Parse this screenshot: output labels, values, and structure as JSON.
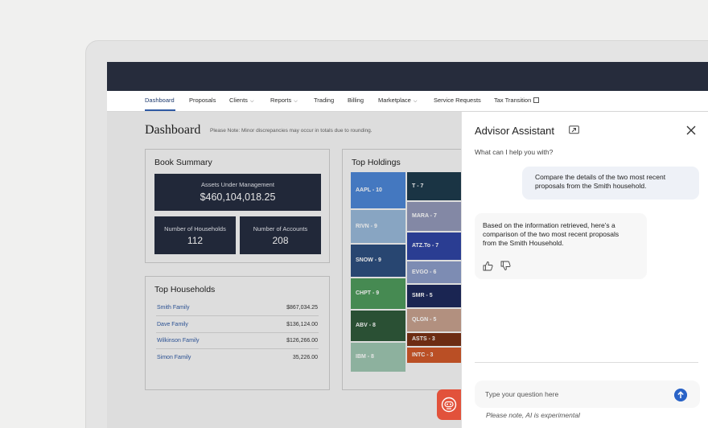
{
  "nav": {
    "items": [
      {
        "label": "Dashboard",
        "active": true
      },
      {
        "label": "Proposals"
      },
      {
        "label": "Clients",
        "dropdown": true
      },
      {
        "label": "Reports",
        "dropdown": true
      },
      {
        "label": "Trading"
      },
      {
        "label": "Billing"
      },
      {
        "label": "Marketplace",
        "dropdown": true
      },
      {
        "label": "Service Requests"
      },
      {
        "label": "Tax Transition",
        "external": true
      }
    ]
  },
  "dashboard": {
    "title": "Dashboard",
    "note": "Please Note: Minor discrepancies may occur in totals due to rounding."
  },
  "book_summary": {
    "title": "Book Summary",
    "aum_label": "Assets Under Management",
    "aum_value": "$460,104,018.25",
    "households_label": "Number of Households",
    "households_value": "112",
    "accounts_label": "Number of Accounts",
    "accounts_value": "208"
  },
  "top_households": {
    "title": "Top Households",
    "rows": [
      {
        "name": "Smith Family",
        "value": "$867,034.25"
      },
      {
        "name": "Dave Family",
        "value": "$136,124.00"
      },
      {
        "name": "Wilkinson Family",
        "value": "$126,266.00"
      },
      {
        "name": "Simon Family",
        "value": "35,226.00"
      }
    ]
  },
  "top_holdings": {
    "title": "Top Holdings",
    "tiles": [
      {
        "label": "AAPL - 10",
        "color": "#4c86d6"
      },
      {
        "label": "RIVN - 9",
        "color": "#98b8d8"
      },
      {
        "label": "SNOW - 9",
        "color": "#2d4e7e"
      },
      {
        "label": "CHPT - 9",
        "color": "#4f9a5c"
      },
      {
        "label": "ABV - 8",
        "color": "#2f5a3a"
      },
      {
        "label": "IBM - 8",
        "color": "#9ec6b0"
      },
      {
        "label": "T - 7",
        "color": "#1e3a4c"
      },
      {
        "label": "MARA - 7",
        "color": "#9298b8"
      },
      {
        "label": "ATZ.To - 7",
        "color": "#2f45a3"
      },
      {
        "label": "EVGO - 6",
        "color": "#8c9cc8"
      },
      {
        "label": "SMR - 5",
        "color": "#1e2a5c"
      },
      {
        "label": "QLGN - 5",
        "color": "#c7a18e"
      },
      {
        "label": "ASTS - 3",
        "color": "#7a3216"
      },
      {
        "label": "INTC - 3",
        "color": "#d0582a"
      }
    ]
  },
  "assistant": {
    "title": "Advisor Assistant",
    "prompt": "What can I help you with?",
    "user_message_line1": "Compare the details of the two most recent",
    "user_message_line2": "proposals from the Smith household.",
    "bot_message_line1": "Based on the information retrieved, here’s a",
    "bot_message_line2": "comparison of the two most recent proposals",
    "bot_message_line3": "from the Smith Household.",
    "input_placeholder": "Type your question here",
    "disclaimer": "Please note, AI is experimental"
  },
  "colors": {
    "navy": "#252d40",
    "accent_blue": "#2a63c7",
    "assistant_button": "#e2523b"
  }
}
